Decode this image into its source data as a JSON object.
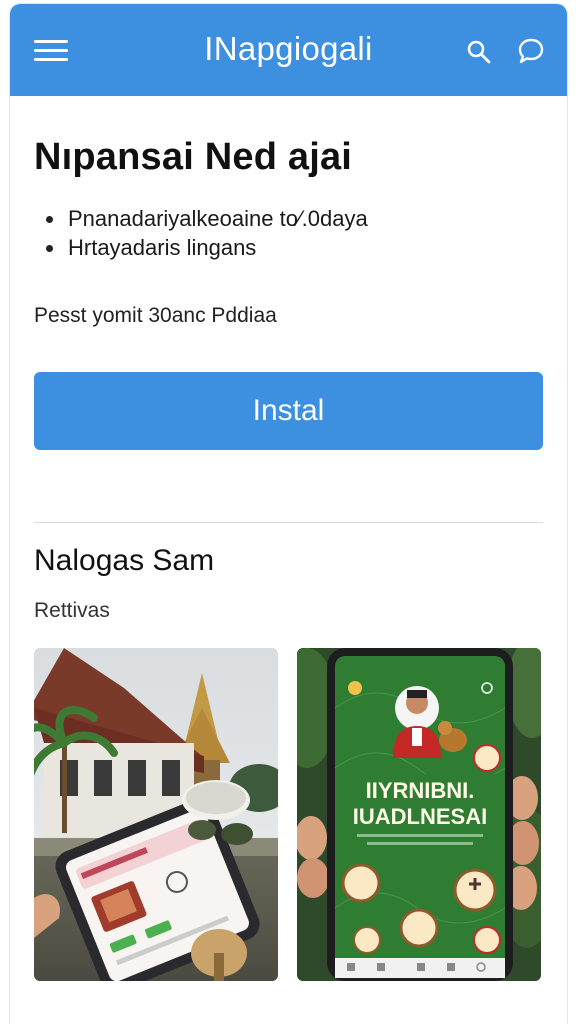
{
  "app_bar": {
    "title": "INapgiogali",
    "menu_icon": "hamburger-menu-icon",
    "search_icon": "search-icon",
    "chat_icon": "chat-bubble-icon",
    "color": "#3d8fe0"
  },
  "main": {
    "headline": "Nıpansai Ned ajai",
    "bullets": [
      "Pnanadariyalkeoaine to⁄.0daya",
      "Hrtayadaris lingans"
    ],
    "subline": "Pesst yomit 30anc Pddiaa",
    "install_label": "Instal"
  },
  "section": {
    "title": "Nalogas Sam",
    "subtitle": "Rettivas"
  },
  "screenshots": {
    "right_phone_title_line1": "IIYRNIBNI.",
    "right_phone_title_line2": "IUADLNESAI"
  }
}
